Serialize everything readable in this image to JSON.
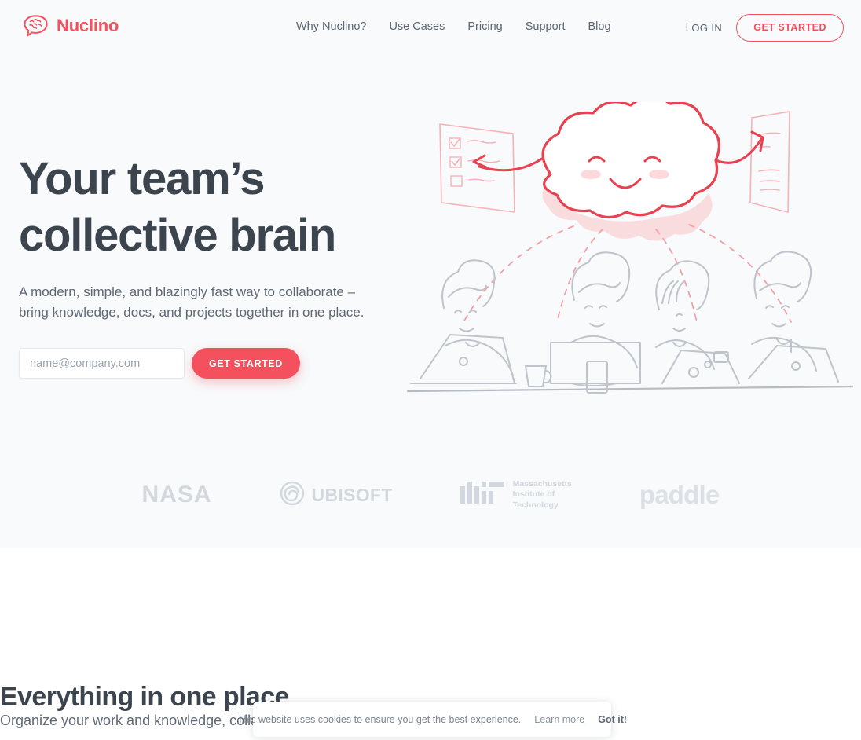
{
  "brand": {
    "name": "Nuclino",
    "accent_color": "#f4505e",
    "text_color": "#3c444d",
    "muted_color": "#5f6874",
    "hero_bg": "#f8fafb",
    "logo_icon": "brain-speech-bubble-icon"
  },
  "header": {
    "nav": [
      {
        "label": "Why Nuclino?"
      },
      {
        "label": "Use Cases"
      },
      {
        "label": "Pricing"
      },
      {
        "label": "Support"
      },
      {
        "label": "Blog"
      }
    ],
    "login_label": "LOG IN",
    "cta_label": "GET STARTED"
  },
  "hero": {
    "title_line1": "Your team’s",
    "title_line2": "collective brain",
    "subtitle_line1": "A modern, simple, and blazingly fast way to collaborate –",
    "subtitle_line2": "bring knowledge, docs, and projects together in one place.",
    "email_placeholder": "name@company.com",
    "email_value": "",
    "cta_label": "GET STARTED",
    "illustration": "smiling-cloud-brain-with-team-illustration"
  },
  "clients": {
    "nasa": {
      "label": "NASA",
      "icon": "nasa-wordmark"
    },
    "ubisoft": {
      "label": "UBISOFT",
      "icon": "ubisoft-swirl-icon"
    },
    "mit": {
      "icon": "mit-bars-logo",
      "line1": "Massachusetts",
      "line2": "Institute of",
      "line3": "Technology"
    },
    "paddle": {
      "label": "paddle",
      "icon": "paddle-wordmark"
    }
  },
  "section2": {
    "title": "Everything in one place",
    "subtitle": "Organize your work and knowledge, collaborate, and more."
  },
  "cookie": {
    "message": "This website uses cookies to ensure you get the best experience.",
    "learn_more": "Learn more",
    "accept": "Got it!"
  }
}
